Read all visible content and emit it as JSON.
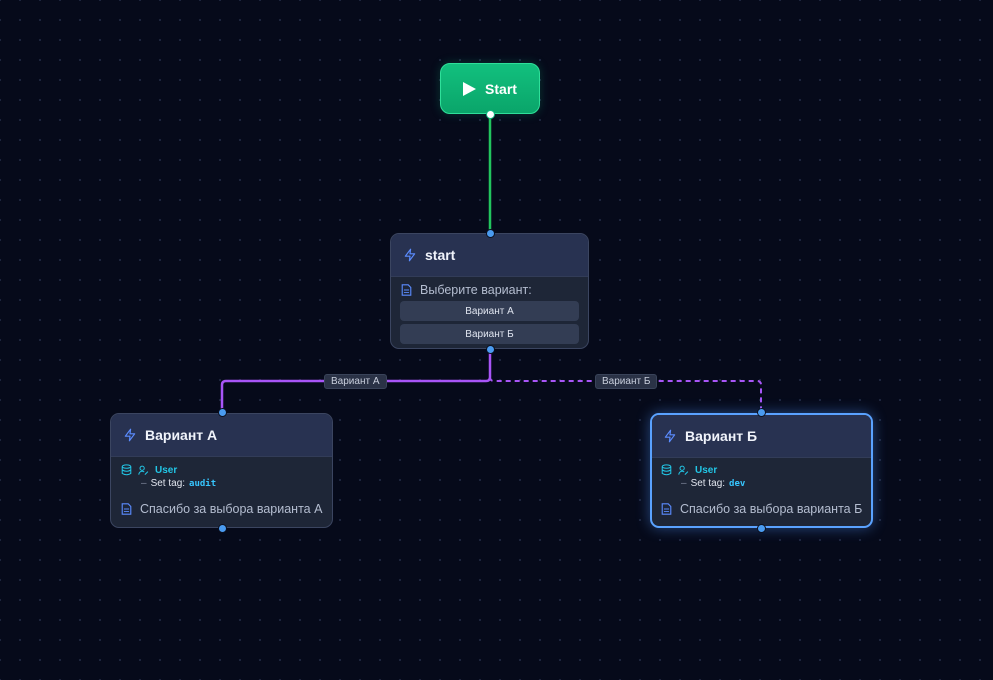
{
  "colors": {
    "background": "#060a1a",
    "start_green": "#10b981",
    "edge_green": "#22c55e",
    "edge_purple": "#a855f7",
    "port_blue": "#4a9bf0",
    "selected_blue": "#5aa2ff",
    "accent_cyan": "#22c6e6"
  },
  "start_node": {
    "label": "Start",
    "icon": "play-icon"
  },
  "nodes": {
    "start": {
      "title": "start",
      "icon": "bolt-icon",
      "message": "Выберите вариант:",
      "options": [
        "Вариант А",
        "Вариант Б"
      ]
    },
    "variant_a": {
      "title": "Вариант А",
      "icon": "bolt-icon",
      "user_label": "User",
      "tag_prefix": "Set tag:",
      "tag": "audit",
      "message": "Спасибо за выбора варианта А"
    },
    "variant_b": {
      "title": "Вариант Б",
      "icon": "bolt-icon",
      "selected": true,
      "user_label": "User",
      "tag_prefix": "Set tag:",
      "tag": "dev",
      "message": "Спасибо за выбора варианта Б"
    }
  },
  "edges": {
    "a_label": "Вариант А",
    "b_label": "Вариант Б"
  }
}
